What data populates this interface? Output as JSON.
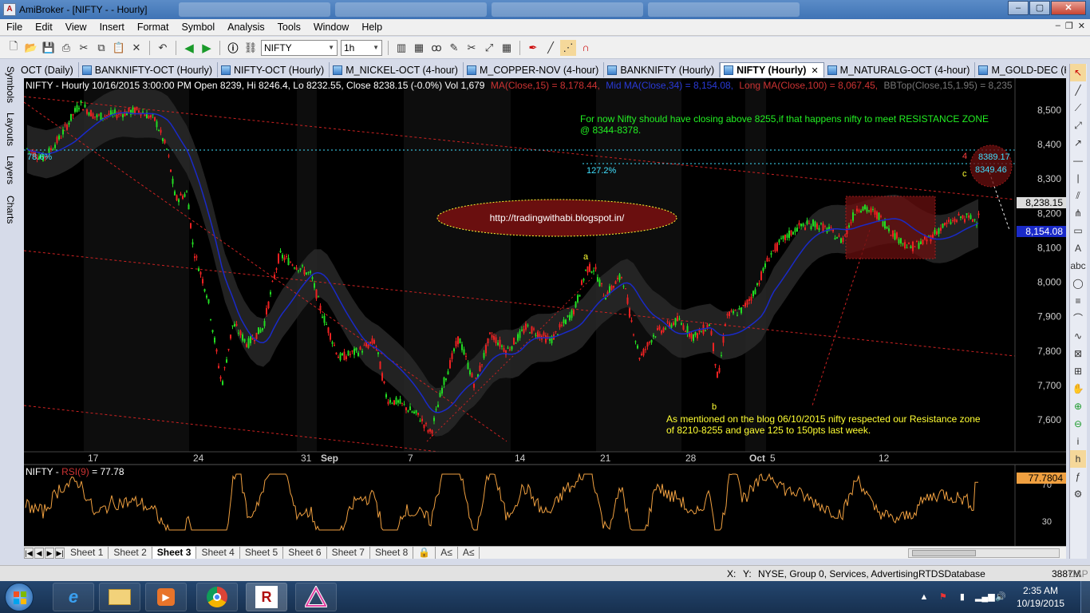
{
  "window": {
    "title": "AmiBroker - [NIFTY -  - Hourly]",
    "controls": {
      "minimize": "–",
      "maximize": "▢",
      "close": "✕"
    }
  },
  "menu": [
    "File",
    "Edit",
    "View",
    "Insert",
    "Format",
    "Symbol",
    "Analysis",
    "Tools",
    "Window",
    "Help"
  ],
  "toolbar": {
    "symbol": "NIFTY",
    "interval": "1h"
  },
  "left_tabs": [
    "Symbols",
    "Layouts",
    "Layers",
    "Charts"
  ],
  "chart_tabs": [
    {
      "label": "OCT (Daily)",
      "active": false
    },
    {
      "label": "BANKNIFTY-OCT (Hourly)",
      "active": false
    },
    {
      "label": "NIFTY-OCT (Hourly)",
      "active": false
    },
    {
      "label": "M_NICKEL-OCT (4-hour)",
      "active": false
    },
    {
      "label": "M_COPPER-NOV (4-hour)",
      "active": false
    },
    {
      "label": "BANKNIFTY (Hourly)",
      "active": false
    },
    {
      "label": "NIFTY (Hourly)",
      "active": true
    },
    {
      "label": "M_NATURALG-OCT (4-hour)",
      "active": false
    },
    {
      "label": "M_GOLD-DEC (Hour",
      "active": false
    }
  ],
  "chart": {
    "header_text": "NIFTY - Hourly 10/16/2015 3:00:00 PM Open 8239, Hi 8246.4, Lo 8232.55, Close 8238.15 (-0.0%) Vol 1,679",
    "ma15_label": "MA(Close,15) = 8,178.44,",
    "mid_ma_label": "Mid MA(Close,34) = 8,154.08,",
    "long_ma_label": "Long MA(Close,100) = 8,067.45,",
    "bbtop_label": "BBTop(Close,15,1.95) = 8,235",
    "annotation_top_line1": "For now Nifty should have closing above 8255,if that happens nifty to meet RESISTANCE ZONE",
    "annotation_top_line2": "@ 8344-8378.",
    "annotation_bottom_line1": "As mentioned on the blog 06/10/2015 nifty respected our Resistance zone",
    "annotation_bottom_line2": "of 8210-8255 and gave 125 to 150pts last week.",
    "url_label": "http://tradingwithabi.blogspot.in/",
    "fib_786": "78.6%",
    "fib_1272": "127.2%",
    "wave_a": "a",
    "wave_b": "b",
    "wave_c": "c",
    "wave_4": "4",
    "level_8389": "8389.17",
    "level_8349": "8349.46",
    "price_tag_close": "8,238.15",
    "price_tag_mid": "8,154.08",
    "price_axis": [
      "8,500",
      "8,400",
      "8,300",
      "8,200",
      "8,100",
      "8,000",
      "7,900",
      "7,800",
      "7,700",
      "7,600"
    ],
    "date_axis": [
      "17",
      "24",
      "31",
      "Sep",
      "7",
      "14",
      "21",
      "28",
      "Oct",
      "5",
      "12"
    ],
    "colors": {
      "up": "#22dd22",
      "down": "#ee2222",
      "mid_ma": "#1a2ac8",
      "rsi": "#f0a040",
      "annotation": "#22ee22",
      "note": "#ffff33",
      "cyan": "#40e0ff"
    }
  },
  "rsi_pane": {
    "label_prefix": "NIFTY - ",
    "label_name": "RSI(9)",
    "label_value": " = 77.78",
    "value_tag": "77.7804",
    "axis": [
      "70",
      "30"
    ]
  },
  "sheets": [
    "Sheet 1",
    "Sheet 2",
    "Sheet 3",
    "Sheet 4",
    "Sheet 5",
    "Sheet 6",
    "Sheet 7",
    "Sheet 8"
  ],
  "active_sheet": "Sheet 3",
  "sheet_nav": [
    "|◀",
    "◀",
    "▶",
    "▶|"
  ],
  "sheet_extra": [
    "A≤",
    "A≤"
  ],
  "status": {
    "x": "X:",
    "y": "Y:",
    "exchange": "NYSE, Group 0, Services, Advertising",
    "db": "RTDSDatabase",
    "memory": "3887M",
    "cap": "CAP"
  },
  "clock": {
    "time": "2:35 AM",
    "date": "10/19/2015"
  }
}
